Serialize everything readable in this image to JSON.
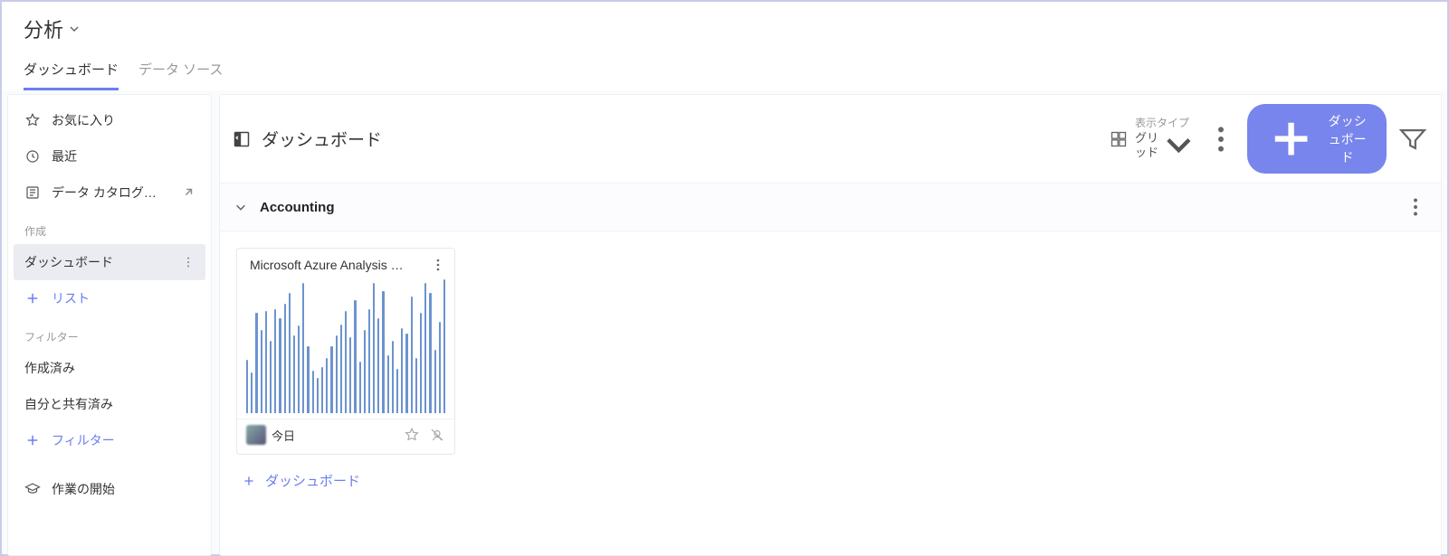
{
  "app_title": "分析",
  "tabs": [
    {
      "label": "ダッシュボード",
      "active": true
    },
    {
      "label": "データ ソース",
      "active": false
    }
  ],
  "sidebar": {
    "favorites_label": "お気に入り",
    "recent_label": "最近",
    "catalog_label": "データ カタログ…",
    "section_create": "作成",
    "dashboard_label": "ダッシュボード",
    "list_label": "リスト",
    "section_filter": "フィルター",
    "created_label": "作成済み",
    "shared_label": "自分と共有済み",
    "filter_add_label": "フィルター",
    "getting_started_label": "作業の開始"
  },
  "main": {
    "title": "ダッシュボード",
    "display_type_label": "表示タイプ",
    "display_type_value": "グリッド",
    "add_button_label": "ダッシュボード",
    "group": {
      "name": "Accounting",
      "card": {
        "title": "Microsoft Azure Analysis …",
        "date": "今日"
      }
    },
    "add_dashboard_label": "ダッシュボード"
  },
  "chart_data": {
    "type": "bar",
    "values": [
      58,
      44,
      108,
      90,
      110,
      78,
      112,
      102,
      118,
      130,
      84,
      95,
      140,
      72,
      46,
      38,
      50,
      60,
      72,
      84,
      96,
      110,
      82,
      122,
      56,
      90,
      112,
      140,
      102,
      132,
      62,
      78,
      48,
      92,
      86,
      126,
      60,
      108,
      140,
      130,
      68,
      98,
      144
    ]
  }
}
